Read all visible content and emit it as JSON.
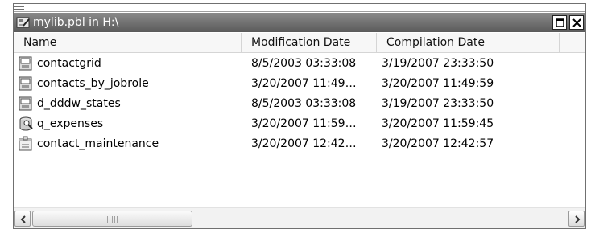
{
  "window": {
    "title": "mylib.pbl in H:\\"
  },
  "columns": {
    "name": "Name",
    "modification": "Modification Date",
    "compilation": "Compilation Date"
  },
  "rows": [
    {
      "name": "contactgrid",
      "modified": "8/5/2003 03:33:08",
      "compiled": "3/19/2007 23:33:50",
      "icon": "datawindow-icon"
    },
    {
      "name": "contacts_by_jobrole",
      "modified": "3/20/2007 11:49…",
      "compiled": "3/20/2007 11:49:59",
      "icon": "datawindow-icon"
    },
    {
      "name": "d_dddw_states",
      "modified": "8/5/2003 03:33:08",
      "compiled": "3/19/2007 23:33:50",
      "icon": "datawindow-icon"
    },
    {
      "name": "q_expenses",
      "modified": "3/20/2007 11:59…",
      "compiled": "3/20/2007 11:59:45",
      "icon": "query-icon"
    },
    {
      "name": "contact_maintenance",
      "modified": "3/20/2007 12:42…",
      "compiled": "3/20/2007 12:42:57",
      "icon": "window-object-icon"
    }
  ]
}
